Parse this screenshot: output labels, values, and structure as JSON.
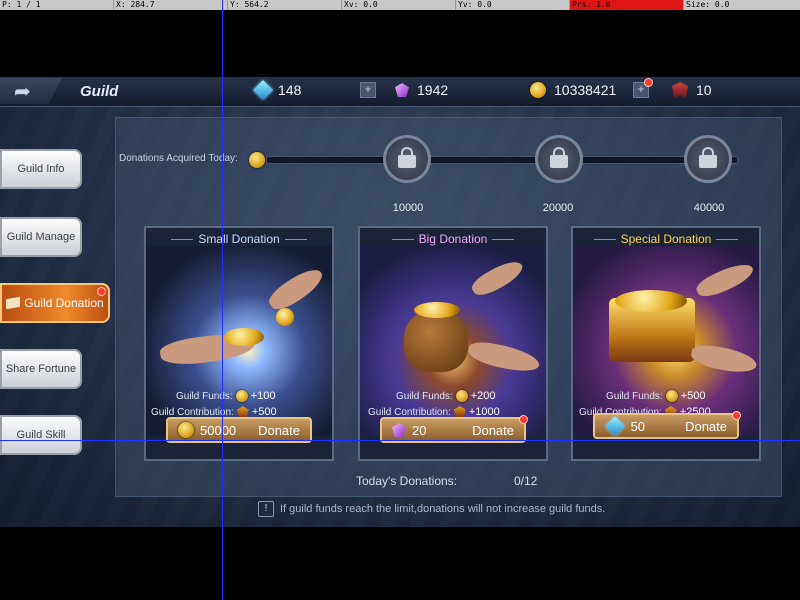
{
  "debug": {
    "p": "P: 1 / 1",
    "x": "X: 284.7",
    "y": "Y: 564.2",
    "xv": "Xv: 0.0",
    "yv": "Yv: 0.0",
    "prs": "Prs: 1.0",
    "size": "Size: 0.0"
  },
  "header": {
    "back_icon": "back-arrow-icon",
    "title": "Guild",
    "diamonds": "148",
    "gems": "1942",
    "gold": "10338421",
    "badges": "10"
  },
  "sidebar": {
    "items": [
      {
        "label": "Guild Info"
      },
      {
        "label": "Guild Manage"
      },
      {
        "label": "Guild Donation"
      },
      {
        "label": "Share Fortune"
      },
      {
        "label": "Guild Skill"
      }
    ]
  },
  "progress": {
    "label": "Donations Acquired Today:",
    "milestones": [
      "10000",
      "20000",
      "40000"
    ]
  },
  "cards": [
    {
      "title": "Small Donation",
      "funds_label": "Guild Funds:",
      "funds_value": "+100",
      "contrib_label": "Guild Contribution:",
      "contrib_value": "+500",
      "cost": "50000",
      "button": "Donate"
    },
    {
      "title": "Big Donation",
      "funds_label": "Guild Funds:",
      "funds_value": "+200",
      "contrib_label": "Guild Contribution:",
      "contrib_value": "+1000",
      "cost": "20",
      "button": "Donate"
    },
    {
      "title": "Special Donation",
      "funds_label": "Guild Funds:",
      "funds_value": "+500",
      "contrib_label": "Guild Contribution:",
      "contrib_value": "+2500",
      "cost": "50",
      "button": "Donate"
    }
  ],
  "today": {
    "label": "Today's Donations:",
    "count": "0/12"
  },
  "notice": "If guild funds reach the limit,donations will not increase guild funds.",
  "colors": {
    "accent_orange": "#f08a2a",
    "notification_red": "#ff3b2f",
    "debug_red": "#e01515"
  }
}
